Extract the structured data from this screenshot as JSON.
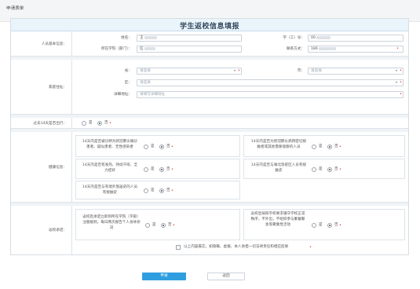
{
  "page": {
    "title": "申请表单"
  },
  "form": {
    "title": "学生返校信息填报",
    "sections": {
      "basic": "人员基本信息：",
      "address": "家庭住址：",
      "travel": "过去14天是否出行：",
      "health": "健康信息：",
      "return": "返校承诺："
    },
    "basic": {
      "name_label": "姓名：",
      "name_value": "王",
      "id_label": "学（工）号：",
      "id_value": "00",
      "college_label": "所在学院（部门）：",
      "college_value": "信",
      "phone_label": "联系方式：",
      "phone_value": "186"
    },
    "address": {
      "province_label": "省：",
      "province_placeholder": "请选择",
      "city_label": "市：",
      "city_placeholder": "请选择",
      "district_label": "区：",
      "district_placeholder": "请选择",
      "detail_label": "详细地址：",
      "detail_placeholder": "请填写详细地址"
    },
    "options": {
      "yes": "是",
      "no": "否"
    },
    "questions": {
      "q1": "14天内是否被诊断为新冠肺炎确诊患者、疑似患者、无性感染者",
      "q2": "14天内是否为新冠肺炎病例密切接触者或其他需要观察的人员",
      "q3": "14天内是否有发热、持续干咳、乏力症状",
      "q4": "14天内是否与湖北等疫区人员有接触史",
      "q5": "14天内是否与有境外旅居史的人员有接触史",
      "r1": "返校后承诺立即到所在学院（学部）注册报到，每日两次报告个人身体状况",
      "r2": "返校后按照学校要求遵守学校正常秩序，不外出，不组织参与聚餐聚会等聚集性活动"
    },
    "declaration": "以上内容属实，如隐瞒、虚报，本人承担一切法律责任和相应后果"
  },
  "buttons": {
    "submit": "申请",
    "back": "返回"
  },
  "colors": {
    "primary": "#2f9ee0",
    "required": "#e03c3c",
    "title_bar": "#e9f4fb"
  }
}
